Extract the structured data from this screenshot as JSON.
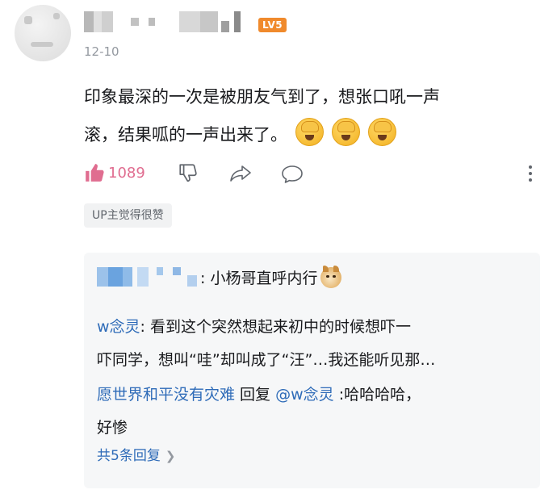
{
  "comment": {
    "username": "",
    "level_badge": "LV5",
    "date": "12-10",
    "text_line1": "印象最深的一次是被朋友气到了，想张口吼一声",
    "text_line2": "滚，结果呱的一声出来了。",
    "emoji_count": 3,
    "likes": "1089",
    "up_tag": "UP主觉得很赞"
  },
  "replies": [
    {
      "user": "",
      "text": ": 小杨哥直呼内行",
      "emoji": "doge-emoji"
    },
    {
      "user": "w念灵",
      "text_a": ": 看到这个突然想起来初中的时候想吓一",
      "text_b": "吓同学，想叫“哇”却叫成了“汪”…我还能听见那…"
    },
    {
      "user": "愿世界和平没有灾难",
      "mid": " 回复 ",
      "mention": "@w念灵",
      "text_a": " :哈哈哈哈，",
      "text_b": "好惨"
    }
  ],
  "more_replies": "共5条回复",
  "icons": [
    "thumbs-up-icon",
    "thumbs-down-icon",
    "share-icon",
    "reply-icon",
    "more-vertical-icon",
    "chevron-right-icon"
  ],
  "colors": {
    "accent_blue": "#2e6bb8",
    "like_pink": "#e06d90",
    "badge_orange": "#f08a2c",
    "reply_bg": "#f6f7f8"
  }
}
